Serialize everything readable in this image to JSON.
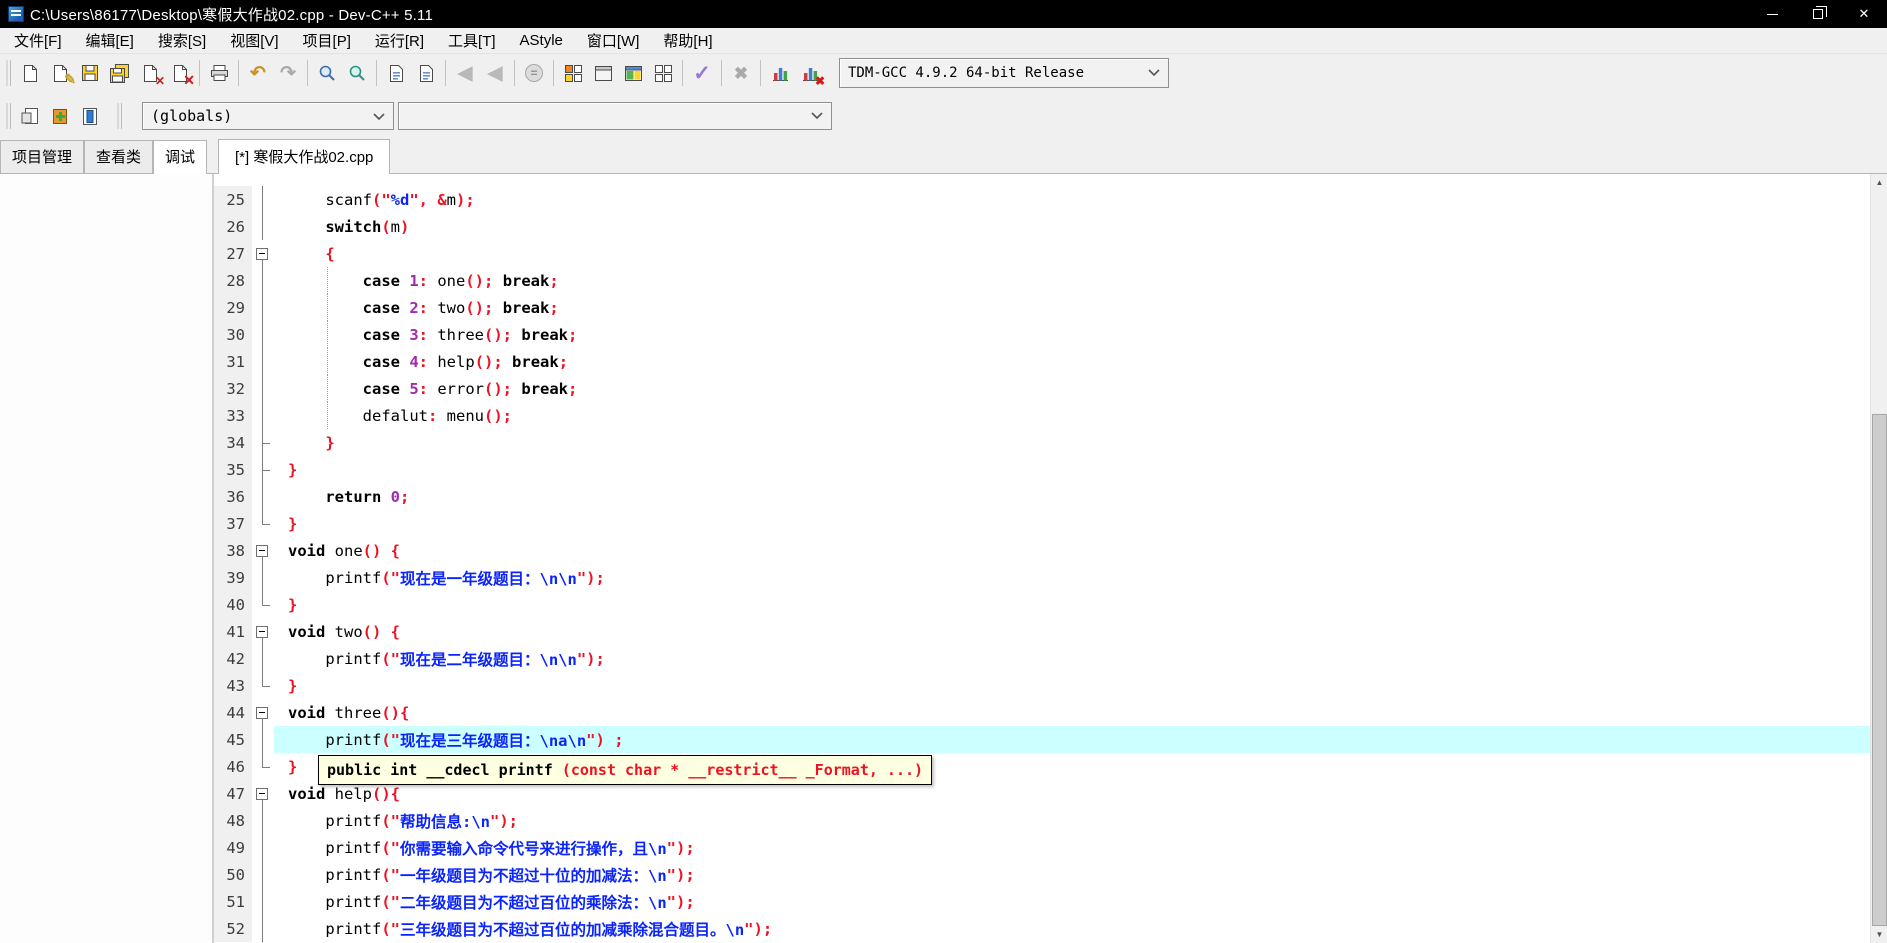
{
  "window": {
    "title": "C:\\Users\\86177\\Desktop\\寒假大作战02.cpp - Dev-C++ 5.11"
  },
  "menu": {
    "items": [
      "文件[F]",
      "编辑[E]",
      "搜索[S]",
      "视图[V]",
      "项目[P]",
      "运行[R]",
      "工具[T]",
      "AStyle",
      "窗口[W]",
      "帮助[H]"
    ]
  },
  "toolbar": {
    "items": [
      "new",
      "open",
      "save",
      "save-all",
      "close",
      "close-all",
      "|",
      "print",
      "|",
      "undo",
      "redo",
      "|",
      "find",
      "replace",
      "|",
      "find-next",
      "goto-line",
      "|",
      "back",
      "forward",
      "|",
      "pause",
      "|",
      "compile",
      "run",
      "compile-and-run",
      "rebuild-all",
      "|",
      "syntax-check",
      "|",
      "abort-compilation",
      "|",
      "profile-analysis",
      "delete-profiling"
    ],
    "compiler_select": {
      "value": "TDM-GCC 4.9.2 64-bit Release"
    }
  },
  "toolbar2": {
    "items": [
      "new-unit",
      "add-to-project",
      "remove-from-project"
    ],
    "globals_select": {
      "value": "(globals)"
    },
    "members_select": {
      "value": ""
    }
  },
  "left_tabs": {
    "items": [
      "项目管理",
      "查看类",
      "调试"
    ],
    "active": "调试"
  },
  "editor_tabs": {
    "items": [
      "[*] 寒假大作战02.cpp"
    ],
    "active": "[*] 寒假大作战02.cpp"
  },
  "editor": {
    "tooltip": {
      "black": "public int __cdecl printf ",
      "red": "(const char * __restrict__ _Format, ...)"
    },
    "lines": [
      {
        "no": 25,
        "fold": "line",
        "tokens": [
          {
            "t": "i",
            "v": "    scanf"
          },
          {
            "t": "p",
            "v": "(\""
          },
          {
            "t": "s",
            "v": "%d"
          },
          {
            "t": "p",
            "v": "\", &"
          },
          {
            "t": "i",
            "v": "m"
          },
          {
            "t": "p",
            "v": ");"
          }
        ]
      },
      {
        "no": 26,
        "fold": "line",
        "tokens": [
          {
            "t": "i",
            "v": "    "
          },
          {
            "t": "k",
            "v": "switch"
          },
          {
            "t": "p",
            "v": "("
          },
          {
            "t": "i",
            "v": "m"
          },
          {
            "t": "p",
            "v": ")"
          }
        ]
      },
      {
        "no": 27,
        "fold": "box",
        "tokens": [
          {
            "t": "i",
            "v": "    "
          },
          {
            "t": "p",
            "v": "{"
          }
        ]
      },
      {
        "no": 28,
        "fold": "line",
        "guide": true,
        "tokens": [
          {
            "t": "i",
            "v": "        "
          },
          {
            "t": "k",
            "v": "case"
          },
          {
            "t": "i",
            "v": " "
          },
          {
            "t": "n",
            "v": "1"
          },
          {
            "t": "p",
            "v": ":"
          },
          {
            "t": "i",
            "v": " one"
          },
          {
            "t": "p",
            "v": "();"
          },
          {
            "t": "i",
            "v": " "
          },
          {
            "t": "k",
            "v": "break"
          },
          {
            "t": "p",
            "v": ";"
          }
        ]
      },
      {
        "no": 29,
        "fold": "line",
        "guide": true,
        "tokens": [
          {
            "t": "i",
            "v": "        "
          },
          {
            "t": "k",
            "v": "case"
          },
          {
            "t": "i",
            "v": " "
          },
          {
            "t": "n",
            "v": "2"
          },
          {
            "t": "p",
            "v": ":"
          },
          {
            "t": "i",
            "v": " two"
          },
          {
            "t": "p",
            "v": "();"
          },
          {
            "t": "i",
            "v": " "
          },
          {
            "t": "k",
            "v": "break"
          },
          {
            "t": "p",
            "v": ";"
          }
        ]
      },
      {
        "no": 30,
        "fold": "line",
        "guide": true,
        "tokens": [
          {
            "t": "i",
            "v": "        "
          },
          {
            "t": "k",
            "v": "case"
          },
          {
            "t": "i",
            "v": " "
          },
          {
            "t": "n",
            "v": "3"
          },
          {
            "t": "p",
            "v": ":"
          },
          {
            "t": "i",
            "v": " three"
          },
          {
            "t": "p",
            "v": "();"
          },
          {
            "t": "i",
            "v": " "
          },
          {
            "t": "k",
            "v": "break"
          },
          {
            "t": "p",
            "v": ";"
          }
        ]
      },
      {
        "no": 31,
        "fold": "line",
        "guide": true,
        "tokens": [
          {
            "t": "i",
            "v": "        "
          },
          {
            "t": "k",
            "v": "case"
          },
          {
            "t": "i",
            "v": " "
          },
          {
            "t": "n",
            "v": "4"
          },
          {
            "t": "p",
            "v": ":"
          },
          {
            "t": "i",
            "v": " help"
          },
          {
            "t": "p",
            "v": "();"
          },
          {
            "t": "i",
            "v": " "
          },
          {
            "t": "k",
            "v": "break"
          },
          {
            "t": "p",
            "v": ";"
          }
        ]
      },
      {
        "no": 32,
        "fold": "line",
        "guide": true,
        "tokens": [
          {
            "t": "i",
            "v": "        "
          },
          {
            "t": "k",
            "v": "case"
          },
          {
            "t": "i",
            "v": " "
          },
          {
            "t": "n",
            "v": "5"
          },
          {
            "t": "p",
            "v": ":"
          },
          {
            "t": "i",
            "v": " error"
          },
          {
            "t": "p",
            "v": "();"
          },
          {
            "t": "i",
            "v": " "
          },
          {
            "t": "k",
            "v": "break"
          },
          {
            "t": "p",
            "v": ";"
          }
        ]
      },
      {
        "no": 33,
        "fold": "line",
        "guide": true,
        "tokens": [
          {
            "t": "i",
            "v": "        defalut"
          },
          {
            "t": "p",
            "v": ":"
          },
          {
            "t": "i",
            "v": " menu"
          },
          {
            "t": "p",
            "v": "();"
          }
        ]
      },
      {
        "no": 34,
        "fold": "tick",
        "tokens": [
          {
            "t": "i",
            "v": "    "
          },
          {
            "t": "p",
            "v": "}"
          }
        ]
      },
      {
        "no": 35,
        "fold": "tick",
        "tokens": [
          {
            "t": "p",
            "v": "}"
          }
        ]
      },
      {
        "no": 36,
        "fold": "line",
        "tokens": [
          {
            "t": "i",
            "v": "    "
          },
          {
            "t": "k",
            "v": "return"
          },
          {
            "t": "i",
            "v": " "
          },
          {
            "t": "n",
            "v": "0"
          },
          {
            "t": "p",
            "v": ";"
          }
        ]
      },
      {
        "no": 37,
        "fold": "end",
        "tokens": [
          {
            "t": "p",
            "v": "}"
          }
        ]
      },
      {
        "no": 38,
        "fold": "box",
        "tokens": [
          {
            "t": "k",
            "v": "void"
          },
          {
            "t": "i",
            "v": " one"
          },
          {
            "t": "p",
            "v": "()"
          },
          {
            "t": "i",
            "v": " "
          },
          {
            "t": "p",
            "v": "{"
          }
        ]
      },
      {
        "no": 39,
        "fold": "line",
        "tokens": [
          {
            "t": "i",
            "v": "    printf"
          },
          {
            "t": "p",
            "v": "(\""
          },
          {
            "t": "s",
            "v": "现在是一年级题目：\\n\\n"
          },
          {
            "t": "p",
            "v": "\");"
          }
        ]
      },
      {
        "no": 40,
        "fold": "end",
        "tokens": [
          {
            "t": "p",
            "v": "}"
          }
        ]
      },
      {
        "no": 41,
        "fold": "box",
        "tokens": [
          {
            "t": "k",
            "v": "void"
          },
          {
            "t": "i",
            "v": " two"
          },
          {
            "t": "p",
            "v": "()"
          },
          {
            "t": "i",
            "v": " "
          },
          {
            "t": "p",
            "v": "{"
          }
        ]
      },
      {
        "no": 42,
        "fold": "line",
        "tokens": [
          {
            "t": "i",
            "v": "    printf"
          },
          {
            "t": "p",
            "v": "(\""
          },
          {
            "t": "s",
            "v": "现在是二年级题目：\\n\\n"
          },
          {
            "t": "p",
            "v": "\");"
          }
        ]
      },
      {
        "no": 43,
        "fold": "end",
        "tokens": [
          {
            "t": "p",
            "v": "}"
          }
        ]
      },
      {
        "no": 44,
        "fold": "box",
        "tokens": [
          {
            "t": "k",
            "v": "void"
          },
          {
            "t": "i",
            "v": " three"
          },
          {
            "t": "p",
            "v": "(){"
          }
        ]
      },
      {
        "no": 45,
        "fold": "line",
        "hl": true,
        "tokens": [
          {
            "t": "i",
            "v": "    printf"
          },
          {
            "t": "p",
            "v": "(\""
          },
          {
            "t": "s",
            "v": "现在是三年级题目：\\na\\n"
          },
          {
            "t": "p",
            "v": "\")"
          },
          {
            "t": "i",
            "v": " "
          },
          {
            "t": "p",
            "v": ";"
          }
        ]
      },
      {
        "no": 46,
        "fold": "end",
        "tokens": [
          {
            "t": "p",
            "v": "}"
          }
        ]
      },
      {
        "no": 47,
        "fold": "box",
        "tokens": [
          {
            "t": "k",
            "v": "void"
          },
          {
            "t": "i",
            "v": " help"
          },
          {
            "t": "p",
            "v": "(){"
          }
        ]
      },
      {
        "no": 48,
        "fold": "line",
        "tokens": [
          {
            "t": "i",
            "v": "    printf"
          },
          {
            "t": "p",
            "v": "(\""
          },
          {
            "t": "s",
            "v": "帮助信息:\\n"
          },
          {
            "t": "p",
            "v": "\");"
          }
        ]
      },
      {
        "no": 49,
        "fold": "line",
        "tokens": [
          {
            "t": "i",
            "v": "    printf"
          },
          {
            "t": "p",
            "v": "(\""
          },
          {
            "t": "s",
            "v": "你需要输入命令代号来进行操作，且\\n"
          },
          {
            "t": "p",
            "v": "\");"
          }
        ]
      },
      {
        "no": 50,
        "fold": "line",
        "tokens": [
          {
            "t": "i",
            "v": "    printf"
          },
          {
            "t": "p",
            "v": "(\""
          },
          {
            "t": "s",
            "v": "一年级题目为不超过十位的加减法：\\n"
          },
          {
            "t": "p",
            "v": "\");"
          }
        ]
      },
      {
        "no": 51,
        "fold": "line",
        "tokens": [
          {
            "t": "i",
            "v": "    printf"
          },
          {
            "t": "p",
            "v": "(\""
          },
          {
            "t": "s",
            "v": "二年级题目为不超过百位的乘除法：\\n"
          },
          {
            "t": "p",
            "v": "\");"
          }
        ]
      },
      {
        "no": 52,
        "fold": "line",
        "tokens": [
          {
            "t": "i",
            "v": "    printf"
          },
          {
            "t": "p",
            "v": "(\""
          },
          {
            "t": "s",
            "v": "三年级题目为不超过百位的加减乘除混合题目。\\n"
          },
          {
            "t": "p",
            "v": "\");"
          }
        ]
      }
    ]
  },
  "colors": {
    "keyword": "#000000",
    "number": "#a02ab0",
    "punctuation": "#ee1122",
    "string": "#0b24fb",
    "line_highlight": "#ccffff",
    "tooltip_bg": "#ffffe1",
    "titlebar_bg": "#000000",
    "chrome_bg": "#f0f0f0"
  }
}
